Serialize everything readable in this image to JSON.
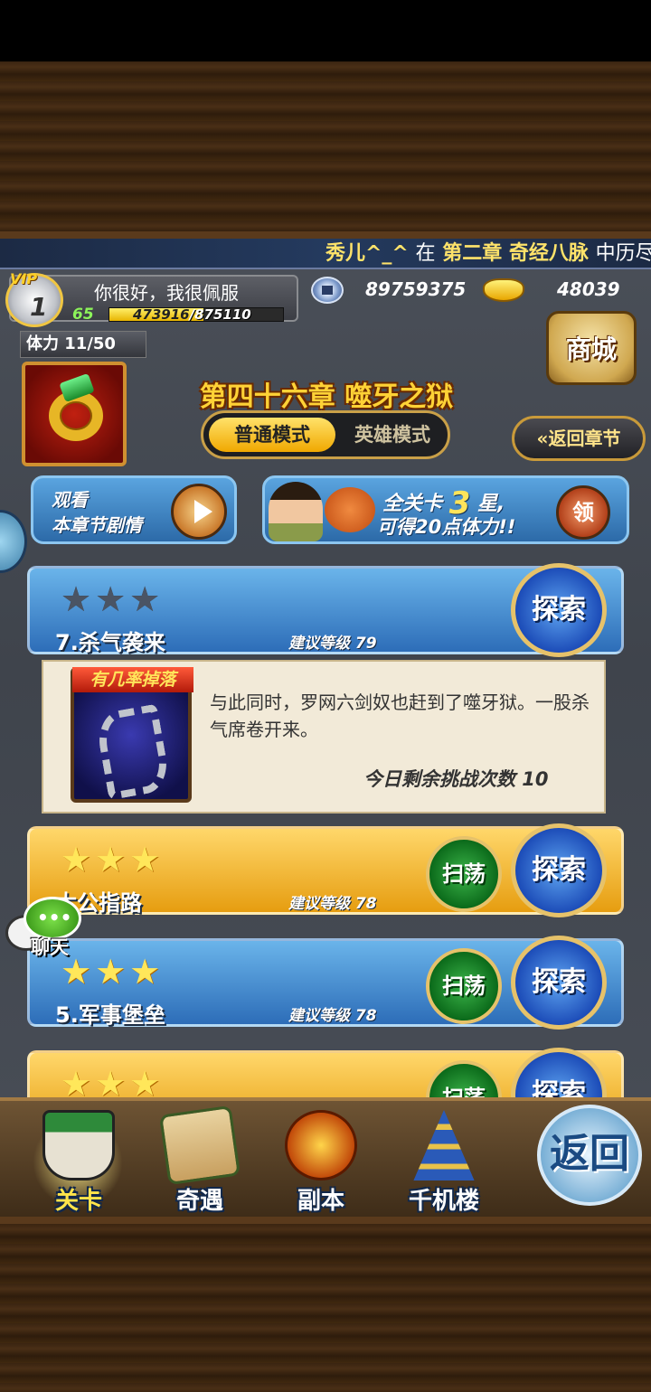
{
  "marquee": {
    "name": "秀儿^_^",
    "word_in": "在",
    "chapter": "第二章 奇经八脉",
    "trailing": "中历尽"
  },
  "player": {
    "vip_tag": "VIP",
    "vip_level": "1",
    "greeting": "你很好，我很佩服",
    "level": "65",
    "exp_current": "473916",
    "exp_sep": "/",
    "exp_max": "875110",
    "exp_fraction": 0.5415,
    "coins": "89759375",
    "gold": "48039",
    "stamina": "体力 11/50"
  },
  "shop_label": "商城",
  "chapter": {
    "title": "第四十六章  噬牙之狱",
    "mode_normal": "普通模式",
    "mode_hero": "英雄模式",
    "back_label": "«返回章节"
  },
  "watch": {
    "line1": "观看",
    "line2": "本章节剧情"
  },
  "reward": {
    "prefix": "全关卡",
    "stars": "3",
    "suffix": "星,",
    "line2": "可得20点体力!!",
    "claim": "领"
  },
  "levels": [
    {
      "name": "7.杀气袭来",
      "rec_label": "建议等级",
      "rec_level": "79",
      "stars": "★★★",
      "explore": "探索"
    },
    {
      "name": "太公指路",
      "rec_label": "建议等级",
      "rec_level": "78",
      "stars": "★★★",
      "explore": "探索",
      "sweep": "扫荡"
    },
    {
      "name": "5.军事堡垒",
      "rec_label": "建议等级",
      "rec_level": "78",
      "stars": "★★★",
      "explore": "探索",
      "sweep": "扫荡"
    },
    {
      "stars": "★★★",
      "explore": "探索",
      "sweep": "扫荡"
    }
  ],
  "detail": {
    "drop_label": "有几率掉落",
    "text": "与此同时，罗网六剑奴也赶到了噬牙狱。一股杀气席卷开来。",
    "remaining": "今日剩余挑战次数 10"
  },
  "chat_label": "聊天",
  "nav": {
    "items": [
      "关卡",
      "奇遇",
      "副本",
      "千机楼"
    ],
    "back": "返回"
  },
  "colors": {
    "accent_gold": "#ffd236",
    "panel_blue": "#2d6db8",
    "panel_gold": "#e69d10"
  }
}
